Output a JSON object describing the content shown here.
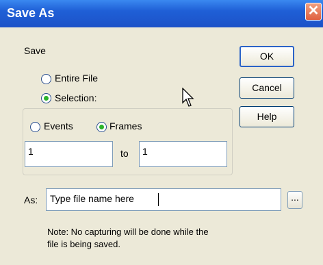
{
  "window": {
    "title": "Save As",
    "close_glyph": "✕"
  },
  "save_section": {
    "label": "Save",
    "options": [
      {
        "label": "Entire File",
        "checked": false
      },
      {
        "label": "Selection:",
        "checked": true
      }
    ]
  },
  "selection_group": {
    "units": [
      {
        "label": "Events",
        "checked": false
      },
      {
        "label": "Frames",
        "checked": true
      }
    ],
    "from_value": "1",
    "to_label": "to",
    "to_value": "1"
  },
  "buttons": {
    "ok": "OK",
    "cancel": "Cancel",
    "help": "Help",
    "browse": "..."
  },
  "filename": {
    "label": "As:",
    "value": "Type file name here"
  },
  "note": "Note: No capturing will be done while the\nfile is being saved."
}
